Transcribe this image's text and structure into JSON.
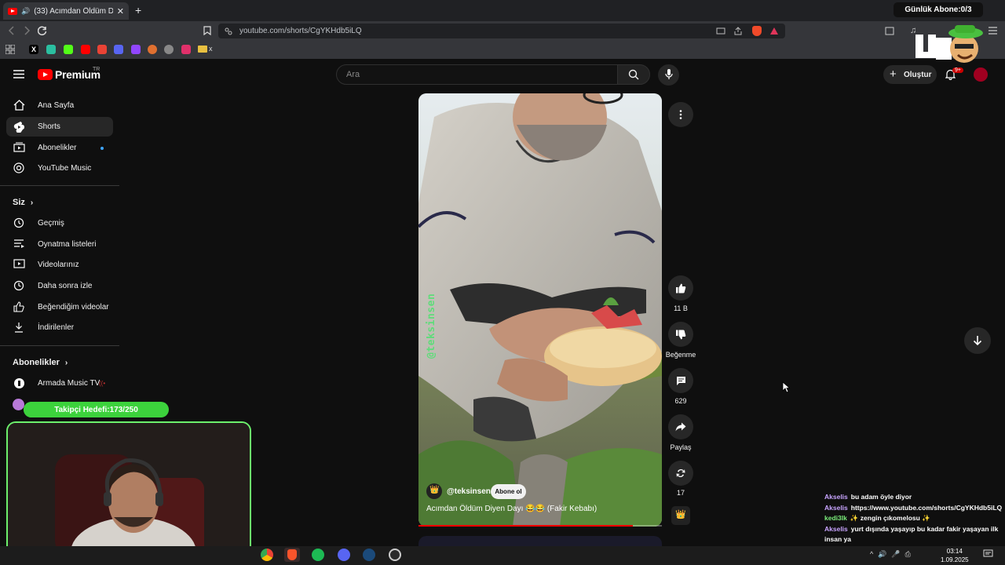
{
  "browser": {
    "tab_title": "(33) Acımdan Öldüm Diyen D",
    "url": "youtube.com/shorts/CgYKHdb5iLQ",
    "stream_goal_top": "Günlük Abone:0/3"
  },
  "masthead": {
    "logo_text": "Premium",
    "logo_region": "TR",
    "search_placeholder": "Ara",
    "create_label": "Oluştur",
    "notif_count": "9+"
  },
  "sidebar": {
    "main": [
      {
        "label": "Ana Sayfa",
        "icon": "home-icon"
      },
      {
        "label": "Shorts",
        "icon": "shorts-icon",
        "active": true
      },
      {
        "label": "Abonelikler",
        "icon": "subscriptions-icon"
      },
      {
        "label": "YouTube Music",
        "icon": "music-icon"
      }
    ],
    "you_heading": "Siz",
    "you": [
      {
        "label": "Geçmiş",
        "icon": "history-icon"
      },
      {
        "label": "Oynatma listeleri",
        "icon": "playlist-icon"
      },
      {
        "label": "Videolarınız",
        "icon": "your-videos-icon"
      },
      {
        "label": "Daha sonra izle",
        "icon": "watch-later-icon"
      },
      {
        "label": "Beğendiğim videolar",
        "icon": "liked-icon"
      },
      {
        "label": "İndirilenler",
        "icon": "download-icon"
      }
    ],
    "subs_heading": "Abonelikler",
    "subs": [
      {
        "label": "Armada Music TV"
      }
    ]
  },
  "short": {
    "watermark": "@teksinsen",
    "channel": "@teksinsen",
    "subscribe": "Abone ol",
    "title": "Acımdan Öldüm Diyen Dayı 😂😂 (Fakir Kebabı)",
    "progress": 0.88
  },
  "actions": {
    "likes": "11 B",
    "dislike": "Beğenme",
    "comments": "629",
    "share": "Paylaş",
    "remix": "17"
  },
  "overlay": {
    "follower_goal": "Takipçi Hedefi:173/250",
    "follower_goal_progress": 0.69
  },
  "chat": [
    {
      "user": "Akselis",
      "msg": "bu adam öyle diyor",
      "color": "#c8a4ff"
    },
    {
      "user": "Akselis",
      "msg": "https://www.youtube.com/shorts/CgYKHdb5iLQ",
      "color": "#c8a4ff"
    },
    {
      "user": "kedi3lk",
      "msg": "✨ zengin çıkomelosu ✨",
      "color": "#7cf07c"
    },
    {
      "user": "Akselis",
      "msg": "yurt dışında yaşayıp bu kadar fakir yaşayan ilk insan ya",
      "color": "#c8a4ff"
    }
  ],
  "taskbar": {
    "time": "03:14",
    "date": "1.09.2025"
  }
}
